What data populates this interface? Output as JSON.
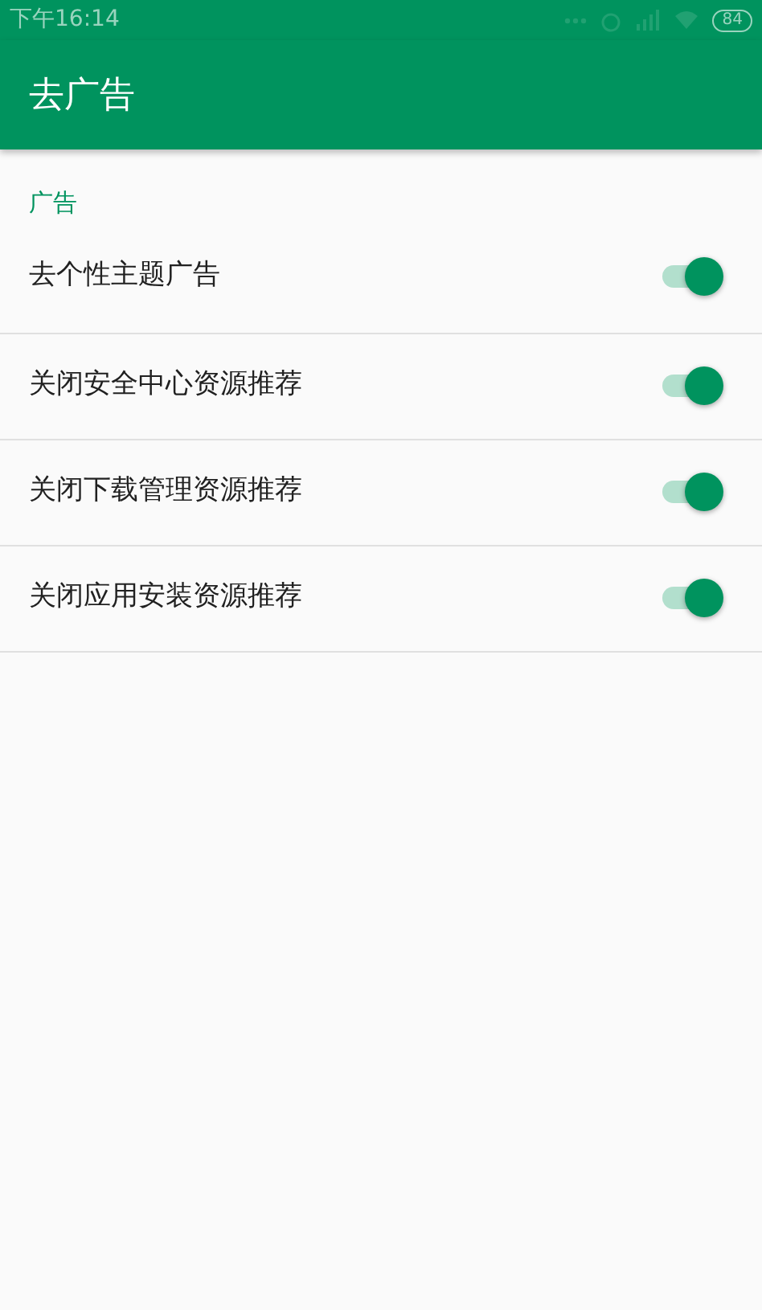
{
  "status_bar": {
    "time": "下午16:14",
    "battery": "84"
  },
  "app_bar": {
    "title": "去广告"
  },
  "section": {
    "title": "广告"
  },
  "settings": [
    {
      "label": "去个性主题广告",
      "on": true
    },
    {
      "label": "关闭安全中心资源推荐",
      "on": true
    },
    {
      "label": "关闭下载管理资源推荐",
      "on": true
    },
    {
      "label": "关闭应用安装资源推荐",
      "on": true
    }
  ]
}
